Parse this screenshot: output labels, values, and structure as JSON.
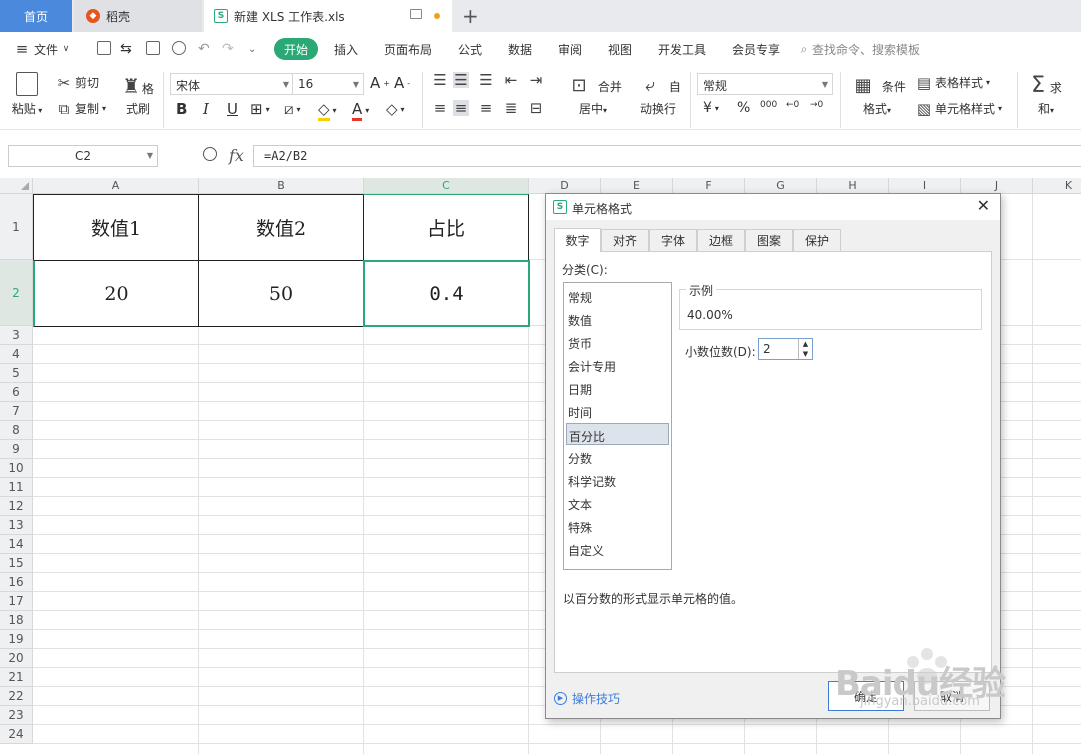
{
  "tabs": {
    "home": "首页",
    "daoke": "稻壳",
    "doc": "新建 XLS 工作表.xls"
  },
  "menu": {
    "file": "文件",
    "items": [
      "开始",
      "插入",
      "页面布局",
      "公式",
      "数据",
      "审阅",
      "视图",
      "开发工具",
      "会员专享"
    ],
    "search": "查找命令、搜索模板"
  },
  "ribbon": {
    "paste": "粘贴",
    "cut": "剪切",
    "copy": "复制",
    "format_painter": "格式刷",
    "font_name": "宋体",
    "font_size": "16",
    "merge_center": "合并居中",
    "wrap_text": "自动换行",
    "number_format": "常规",
    "conditional_format": "条件格式",
    "table_style": "表格样式",
    "cell_style": "单元格样式",
    "sum": "求和",
    "currency_sym": "¥",
    "percent_sym": "%",
    "thousands_sym": "000"
  },
  "formula_bar": {
    "cell_ref": "C2",
    "formula": "=A2/B2"
  },
  "sheet": {
    "columns": [
      "A",
      "B",
      "C",
      "D",
      "E",
      "F",
      "G",
      "H",
      "I",
      "J",
      "K"
    ],
    "row1": [
      "数值1",
      "数值2",
      "占比"
    ],
    "row2": [
      "20",
      "50",
      "0.4"
    ],
    "row_numbers": [
      "1",
      "2",
      "3",
      "4",
      "5",
      "6",
      "7",
      "8",
      "9",
      "10",
      "11",
      "12",
      "13",
      "14",
      "15",
      "16",
      "17",
      "18",
      "19",
      "20",
      "21",
      "22",
      "23",
      "24"
    ]
  },
  "dialog": {
    "title": "单元格格式",
    "tabs": [
      "数字",
      "对齐",
      "字体",
      "边框",
      "图案",
      "保护"
    ],
    "category_label": "分类(C):",
    "categories": [
      "常规",
      "数值",
      "货币",
      "会计专用",
      "日期",
      "时间",
      "百分比",
      "分数",
      "科学记数",
      "文本",
      "特殊",
      "自定义"
    ],
    "selected_category": "百分比",
    "sample_label": "示例",
    "sample_value": "40.00%",
    "decimal_label": "小数位数(D):",
    "decimal_value": "2",
    "description": "以百分数的形式显示单元格的值。",
    "tips": "操作技巧",
    "ok": "确定",
    "cancel": "取消"
  },
  "watermark": {
    "brand": "Baidu经验",
    "url": "jingyan.baidu.com"
  },
  "colors": {
    "accent": "#2aa876",
    "home_tab": "#4a89dc",
    "arrow": "#e8352c"
  }
}
